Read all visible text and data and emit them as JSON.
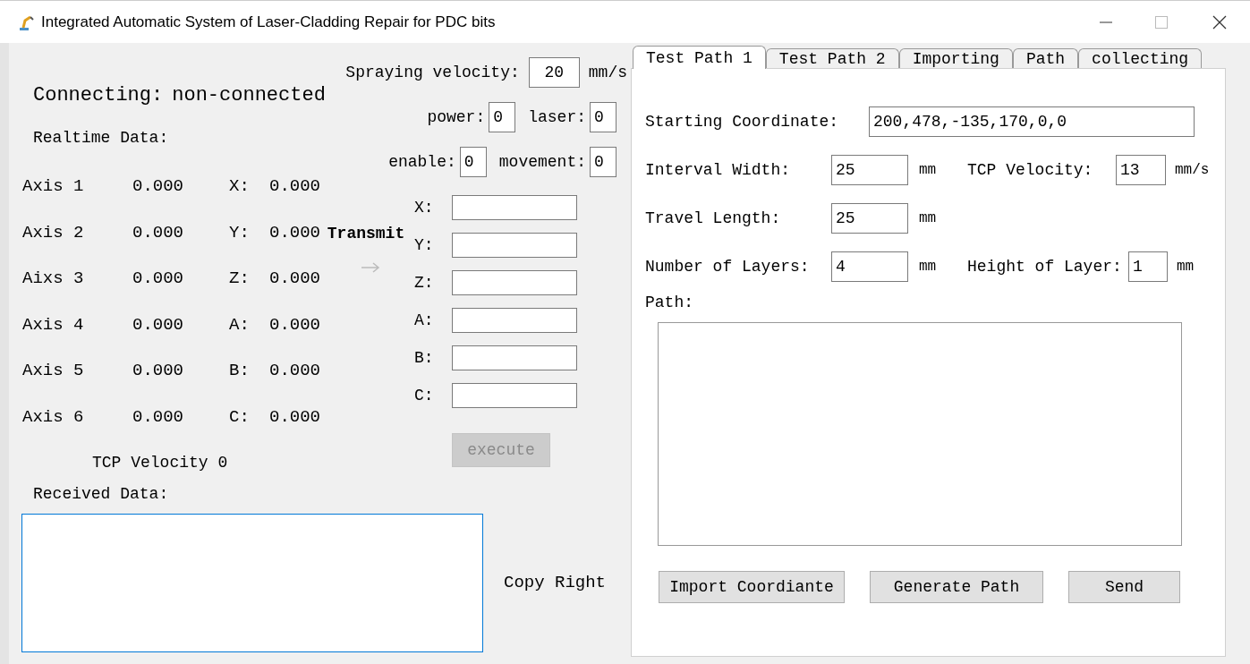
{
  "window": {
    "title": "Integrated Automatic System of Laser-Cladding Repair for PDC bits"
  },
  "spraying": {
    "label": "Spraying velocity:",
    "value": "20",
    "unit": "mm/s"
  },
  "connection": {
    "label": "Connecting:",
    "status": "non-connected"
  },
  "realtime": {
    "title": "Realtime Data:",
    "axes": [
      {
        "name": "Axis 1",
        "value": "0.000",
        "coord_label": "X:",
        "coord_value": "0.000"
      },
      {
        "name": "Axis 2",
        "value": "0.000",
        "coord_label": "Y:",
        "coord_value": "0.000"
      },
      {
        "name": "Aixs 3",
        "value": "0.000",
        "coord_label": "Z:",
        "coord_value": "0.000"
      },
      {
        "name": "Axis 4",
        "value": "0.000",
        "coord_label": "A:",
        "coord_value": "0.000"
      },
      {
        "name": "Axis 5",
        "value": "0.000",
        "coord_label": "B:",
        "coord_value": "0.000"
      },
      {
        "name": "Axis 6",
        "value": "0.000",
        "coord_label": "C:",
        "coord_value": "0.000"
      }
    ],
    "tcp_velocity": "TCP Velocity 0"
  },
  "io": [
    [
      {
        "label": "power:",
        "value": "0"
      },
      {
        "label": "laser:",
        "value": "0"
      }
    ],
    [
      {
        "label": "enable:",
        "value": "0"
      },
      {
        "label": "movement:",
        "value": "0"
      }
    ]
  ],
  "transmit": {
    "label": "Transmit",
    "fields": [
      "X:",
      "Y:",
      "Z:",
      "A:",
      "B:",
      "C:"
    ],
    "button": {
      "label": "execute",
      "disabled": true
    }
  },
  "received": {
    "label": "Received Data:"
  },
  "copyright": "Copy Right",
  "tabs": [
    {
      "label": "Test Path 1",
      "selected": true
    },
    {
      "label": "Test Path 2",
      "selected": false
    },
    {
      "label": "Importing",
      "selected": false
    },
    {
      "label": "Path",
      "selected": false
    },
    {
      "label": "collecting",
      "selected": false
    }
  ],
  "test_path": {
    "starting": {
      "label": "Starting Coordinate:",
      "value": "200,478,-135,170,0,0"
    },
    "interval": {
      "label": "Interval Width:",
      "value": "25",
      "unit": "mm"
    },
    "tcp": {
      "label": "TCP Velocity:",
      "value": "13",
      "unit": "mm/s"
    },
    "travel": {
      "label": "Travel Length:",
      "value": "25",
      "unit": "mm"
    },
    "layers": {
      "label": "Number of Layers:",
      "value": "4",
      "unit": "mm"
    },
    "height": {
      "label": "Height of Layer:",
      "value": "1",
      "unit": "mm"
    },
    "path_label": "Path:",
    "buttons": [
      "Import Coordiante",
      "Generate Path",
      "Send"
    ]
  }
}
